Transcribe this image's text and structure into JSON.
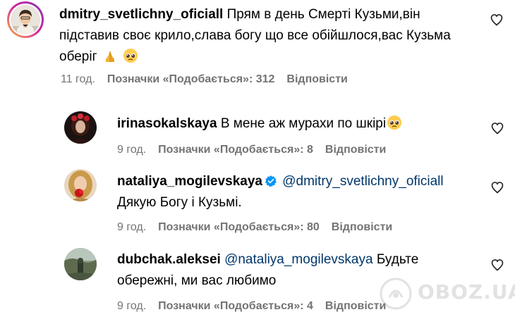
{
  "comments": [
    {
      "username": "dmitry_svetlichny_oficiall",
      "text": "Прям в день Смерті Кузьми,він підставив своє крило,слава богу що все обійшлося,вас Кузьма оберіг",
      "time": "11 год.",
      "likes": "Позначки «Подобається»: 312",
      "reply": "Відповісти",
      "emoji_icons": [
        "praying-hands-icon",
        "pleading-face-icon"
      ]
    },
    {
      "username": "irinasokalskaya",
      "text": "В мене аж мурахи по шкірі",
      "time": "9 год.",
      "likes": "Позначки «Подобається»: 8",
      "reply": "Відповісти",
      "emoji_icons": [
        "pleading-face-icon"
      ]
    },
    {
      "username": "nataliya_mogilevskaya",
      "verified": true,
      "mention": "@dmitry_svetlichny_oficiall",
      "text": "Дякую Богу і Кузьмі.",
      "time": "9 год.",
      "likes": "Позначки «Подобається»: 80",
      "reply": "Відповісти"
    },
    {
      "username": "dubchak.aleksei",
      "mention": "@nataliya_mogilevskaya",
      "text_line1": "Будьте",
      "text_line2": "обережні, ми вас любимо",
      "time": "9 год.",
      "likes": "Позначки «Подобається»: 4",
      "reply": "Відповісти"
    }
  ],
  "watermark": {
    "text": "OBOZ.UA"
  },
  "colors": {
    "text": "#000000",
    "meta": "#737373",
    "mention": "#00376b",
    "verified": "#0095f6",
    "story_ring": "#d6249f"
  }
}
